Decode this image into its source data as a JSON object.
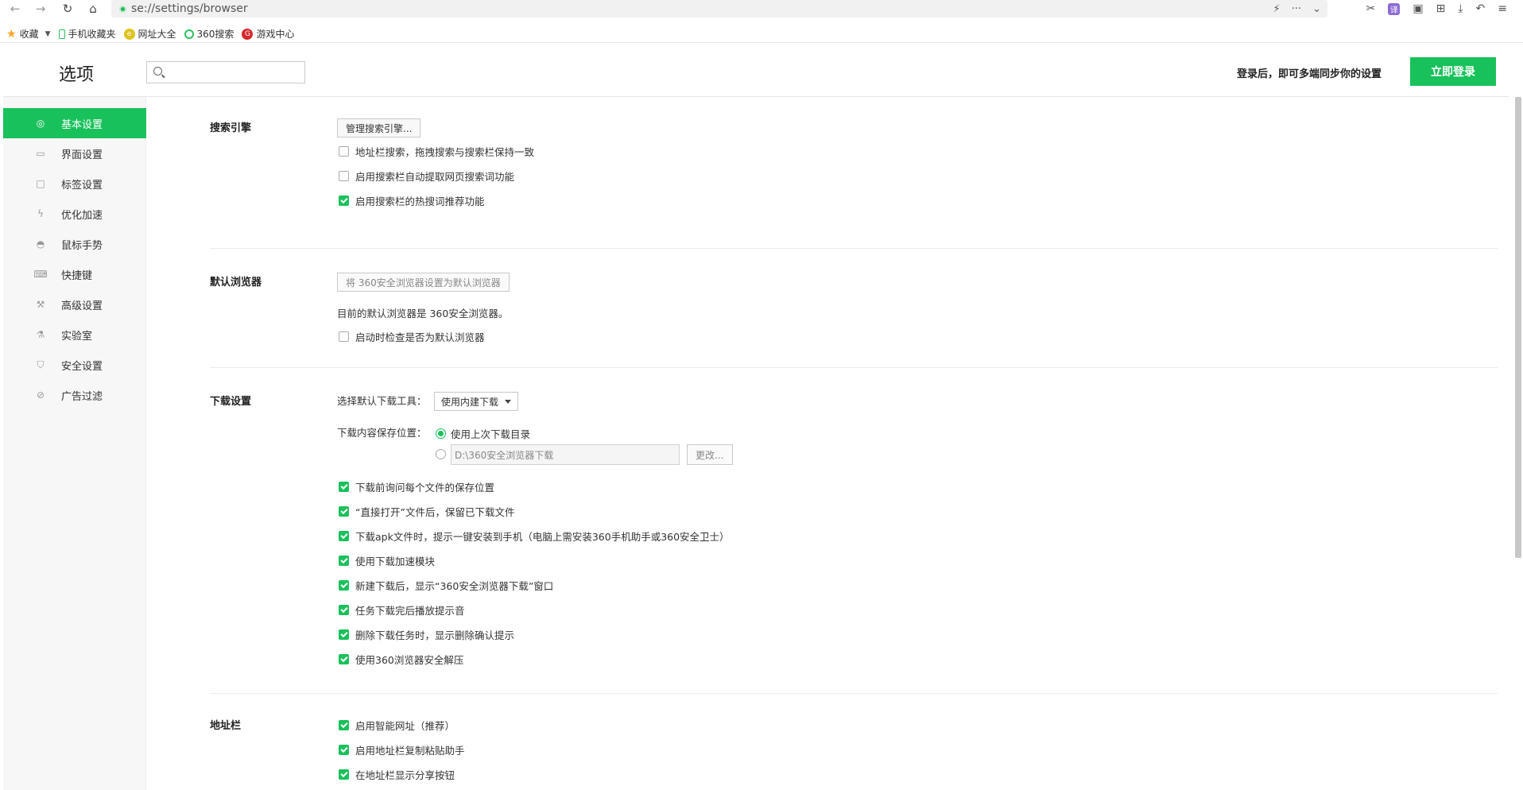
{
  "browser": {
    "url": "se://settings/browser",
    "bookmarks": [
      {
        "label": "收藏",
        "icon": "star-icon"
      },
      {
        "label": "手机收藏夹",
        "icon": "phone-icon"
      },
      {
        "label": "网址大全",
        "icon": "nav-site-icon"
      },
      {
        "label": "360搜索",
        "icon": "so-icon"
      },
      {
        "label": "游戏中心",
        "icon": "game-icon"
      }
    ],
    "translate_label": "译"
  },
  "header": {
    "title": "选项",
    "search_placeholder": "",
    "sync_text": "登录后，即可多端同步你的设置",
    "login_label": "立即登录"
  },
  "sidebar": {
    "items": [
      {
        "label": "基本设置",
        "icon": "target-icon",
        "active": true
      },
      {
        "label": "界面设置",
        "icon": "window-icon"
      },
      {
        "label": "标签设置",
        "icon": "tab-icon"
      },
      {
        "label": "优化加速",
        "icon": "lightning-icon"
      },
      {
        "label": "鼠标手势",
        "icon": "mouse-icon"
      },
      {
        "label": "快捷键",
        "icon": "keyboard-icon"
      },
      {
        "label": "高级设置",
        "icon": "wrench-icon"
      },
      {
        "label": "实验室",
        "icon": "flask-icon"
      },
      {
        "label": "安全设置",
        "icon": "shield-icon"
      },
      {
        "label": "广告过滤",
        "icon": "block-icon"
      }
    ]
  },
  "sections": {
    "search": {
      "title": "搜索引擎",
      "manage_label": "管理搜索引擎...",
      "options": [
        {
          "label": "地址栏搜索，拖拽搜索与搜索栏保持一致",
          "checked": false
        },
        {
          "label": "启用搜索栏自动提取网页搜索词功能",
          "checked": false
        },
        {
          "label": "启用搜索栏的热搜词推荐功能",
          "checked": true
        }
      ]
    },
    "default_browser": {
      "title": "默认浏览器",
      "set_default_label": "将 360安全浏览器设置为默认浏览器",
      "current_text": "目前的默认浏览器是 360安全浏览器。",
      "options": [
        {
          "label": "启动时检查是否为默认浏览器",
          "checked": false
        }
      ]
    },
    "download": {
      "title": "下载设置",
      "tool_label": "选择默认下载工具：",
      "tool_value": "使用内建下载",
      "location_label": "下载内容保存位置：",
      "radio_last_dir": "使用上次下载目录",
      "path_value": "D:\\360安全浏览器下载",
      "change_label": "更改...",
      "options": [
        {
          "label": "下载前询问每个文件的保存位置",
          "checked": true
        },
        {
          "label": "“直接打开”文件后，保留已下载文件",
          "checked": true
        },
        {
          "label": "下载apk文件时，提示一键安装到手机（电脑上需安装360手机助手或360安全卫士）",
          "checked": true
        },
        {
          "label": "使用下载加速模块",
          "checked": true
        },
        {
          "label": "新建下载后，显示“360安全浏览器下载”窗口",
          "checked": true
        },
        {
          "label": "任务下载完后播放提示音",
          "checked": true
        },
        {
          "label": "删除下载任务时，显示删除确认提示",
          "checked": true
        },
        {
          "label": "使用360浏览器安全解压",
          "checked": true
        }
      ]
    },
    "address_bar": {
      "title": "地址栏",
      "options": [
        {
          "label": "启用智能网址（推荐）",
          "checked": true
        },
        {
          "label": "启用地址栏复制粘贴助手",
          "checked": true
        },
        {
          "label": "在地址栏显示分享按钮",
          "checked": true
        }
      ]
    }
  },
  "colors": {
    "accent": "#19c15b",
    "sidebar_bg": "#f7f7f7"
  }
}
